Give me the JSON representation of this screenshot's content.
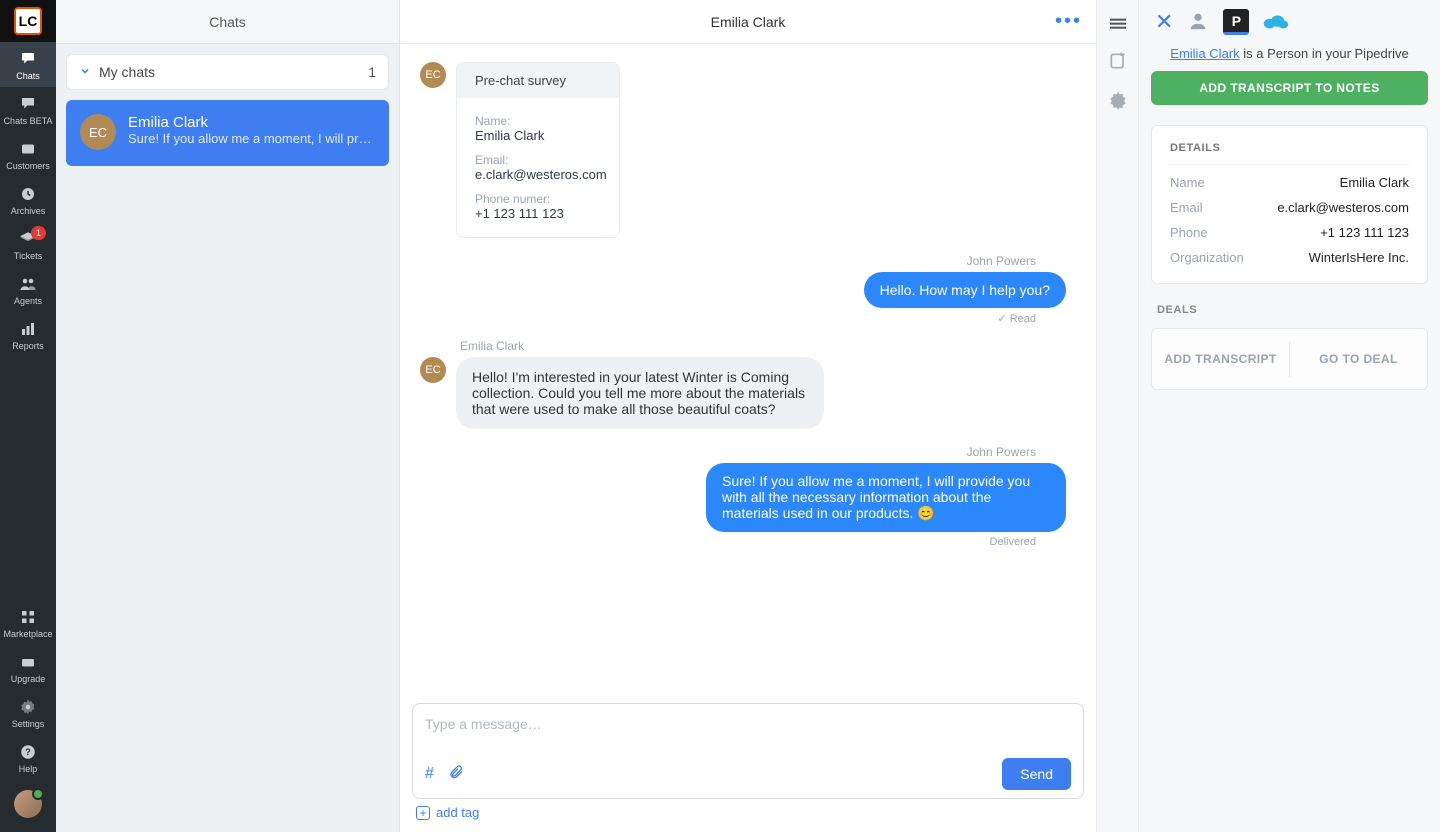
{
  "nav": {
    "logo_text": "LC",
    "items": [
      {
        "key": "chats",
        "label": "Chats",
        "active": true
      },
      {
        "key": "chats-beta",
        "label": "Chats BETA"
      },
      {
        "key": "customers",
        "label": "Customers"
      },
      {
        "key": "archives",
        "label": "Archives"
      },
      {
        "key": "tickets",
        "label": "Tickets",
        "badge": "1"
      },
      {
        "key": "agents",
        "label": "Agents"
      },
      {
        "key": "reports",
        "label": "Reports"
      }
    ],
    "bottom_items": [
      {
        "key": "marketplace",
        "label": "Marketplace"
      },
      {
        "key": "upgrade",
        "label": "Upgrade"
      },
      {
        "key": "settings",
        "label": "Settings"
      },
      {
        "key": "help",
        "label": "Help"
      }
    ]
  },
  "chats_panel": {
    "title": "Chats",
    "filter_label": "My chats",
    "filter_count": "1",
    "card": {
      "initials": "EC",
      "name": "Emilia Clark",
      "preview": "Sure! If you allow me a moment, I will provid..."
    }
  },
  "conversation": {
    "title": "Emilia Clark",
    "survey": {
      "head": "Pre-chat survey",
      "name_label": "Name:",
      "name_value": "Emilia Clark",
      "email_label": "Email:",
      "email_value": "e.clark@westeros.com",
      "phone_label": "Phone numer:",
      "phone_value": "+1 123 111 123"
    },
    "agent_sender": "John Powers",
    "agent_msg1": "Hello. How may I help you?",
    "read_status": "Read",
    "customer_sender": "Emilia Clark",
    "customer_msg": "Hello! I'm interested in your latest Winter is Coming collection. Could you tell me more about the materials that were used to make all those beautiful coats?",
    "agent_msg2": "Sure! If you allow me a moment, I will provide you with all the necessary information about the materials used in our products. 😊",
    "delivered_status": "Delivered",
    "composer_placeholder": "Type a message…",
    "send_label": "Send",
    "add_tag_label": "add tag",
    "ec_initials": "EC"
  },
  "right": {
    "pd_letter": "P",
    "intro_link": "Emilia Clark",
    "intro_rest": " is a Person in your Pipedrive",
    "cta": "ADD TRANSCRIPT TO NOTES",
    "details_heading": "DETAILS",
    "rows": {
      "name_k": "Name",
      "name_v": "Emilia Clark",
      "email_k": "Email",
      "email_v": "e.clark@westeros.com",
      "phone_k": "Phone",
      "phone_v": "+1 123 111 123",
      "org_k": "Organization",
      "org_v": "WinterIsHere Inc."
    },
    "deals_heading": "DEALS",
    "deal_add": "ADD TRANSCRIPT",
    "deal_go": "GO TO DEAL"
  }
}
